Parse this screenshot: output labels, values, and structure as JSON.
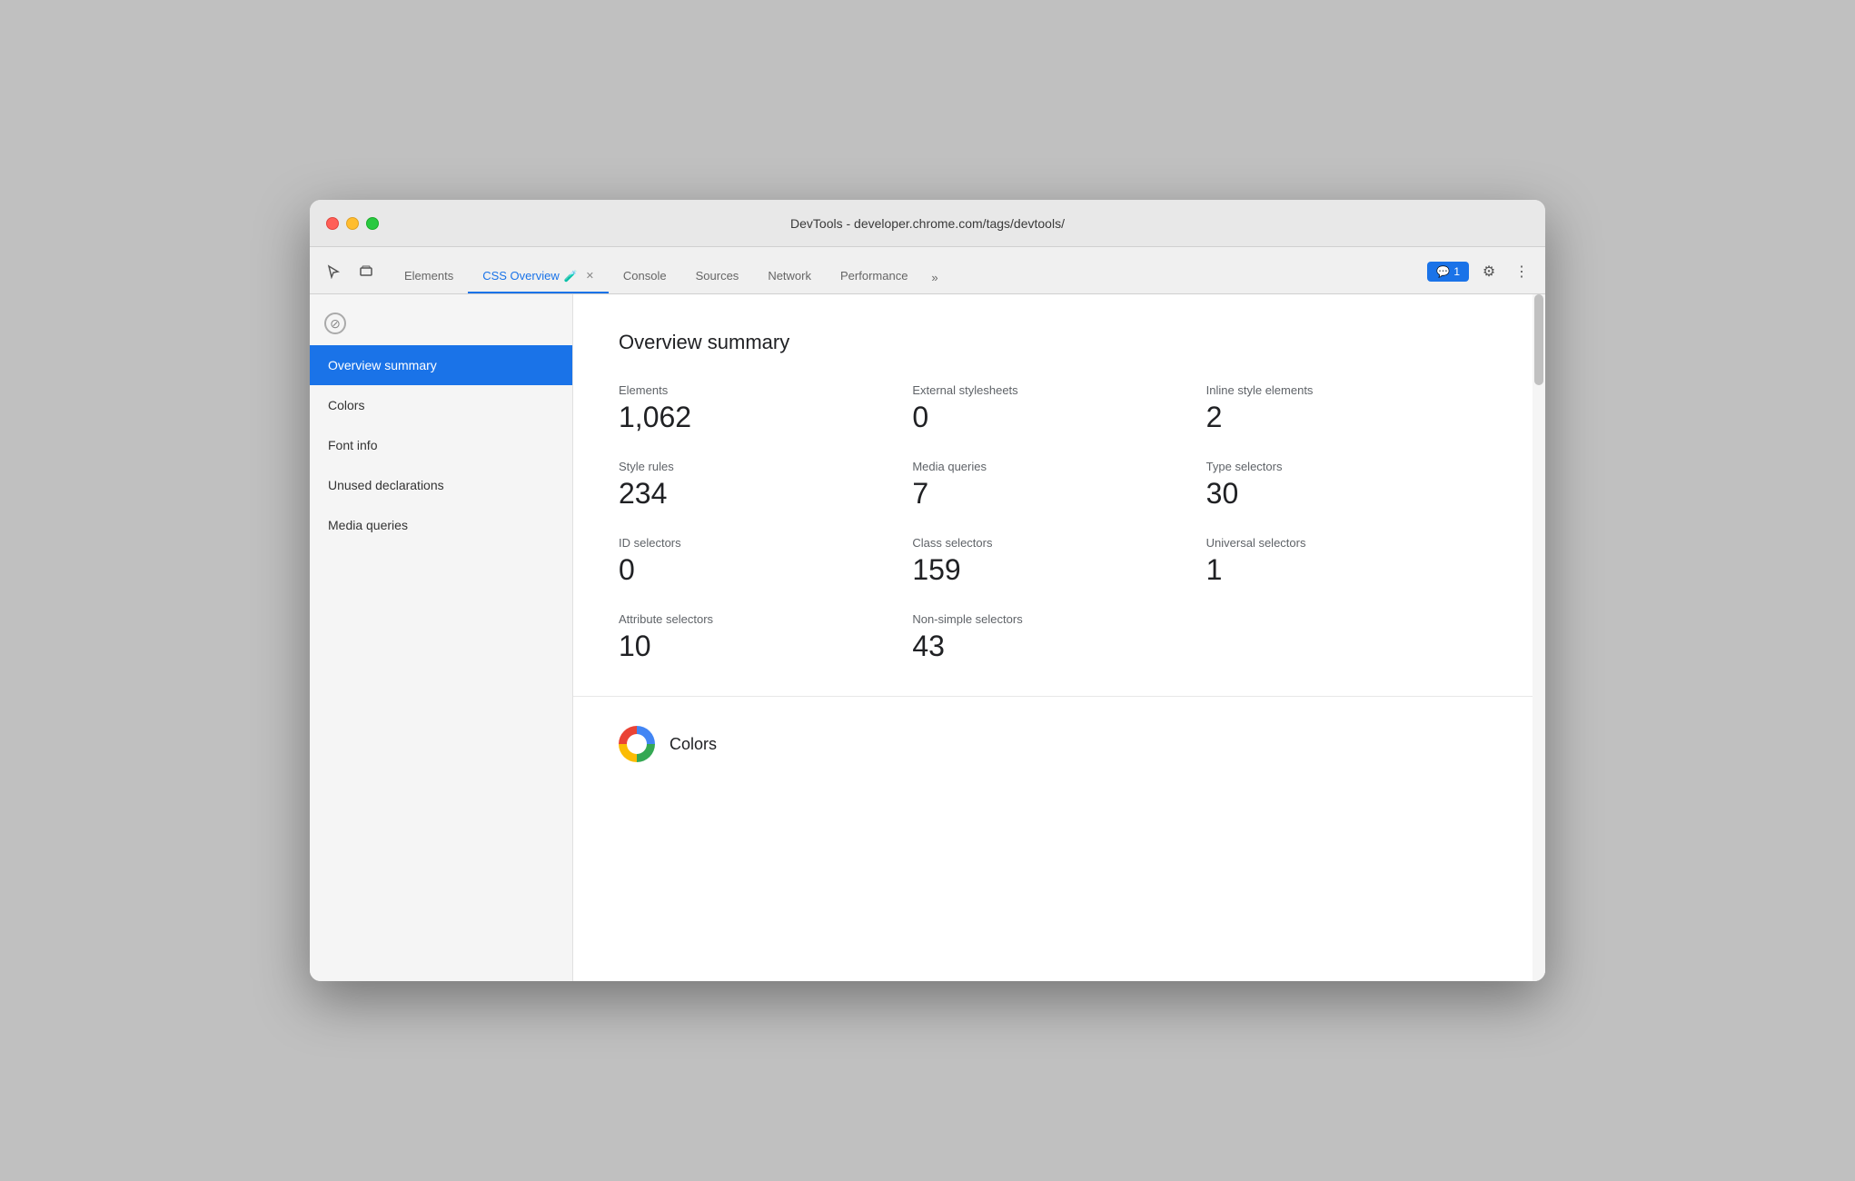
{
  "window": {
    "title": "DevTools - developer.chrome.com/tags/devtools/"
  },
  "tabs": [
    {
      "id": "elements",
      "label": "Elements",
      "active": false
    },
    {
      "id": "css-overview",
      "label": "CSS Overview",
      "active": true,
      "hasFlask": true,
      "hasClose": true
    },
    {
      "id": "console",
      "label": "Console",
      "active": false
    },
    {
      "id": "sources",
      "label": "Sources",
      "active": false
    },
    {
      "id": "network",
      "label": "Network",
      "active": false
    },
    {
      "id": "performance",
      "label": "Performance",
      "active": false
    }
  ],
  "tab_overflow_label": "»",
  "notification": {
    "icon": "💬",
    "count": "1"
  },
  "sidebar": {
    "items": [
      {
        "id": "overview-summary",
        "label": "Overview summary",
        "active": true
      },
      {
        "id": "colors",
        "label": "Colors",
        "active": false
      },
      {
        "id": "font-info",
        "label": "Font info",
        "active": false
      },
      {
        "id": "unused-declarations",
        "label": "Unused declarations",
        "active": false
      },
      {
        "id": "media-queries",
        "label": "Media queries",
        "active": false
      }
    ]
  },
  "main": {
    "overview_title": "Overview summary",
    "stats": [
      {
        "id": "elements",
        "label": "Elements",
        "value": "1,062"
      },
      {
        "id": "external-stylesheets",
        "label": "External stylesheets",
        "value": "0"
      },
      {
        "id": "inline-style-elements",
        "label": "Inline style elements",
        "value": "2"
      },
      {
        "id": "style-rules",
        "label": "Style rules",
        "value": "234"
      },
      {
        "id": "media-queries",
        "label": "Media queries",
        "value": "7"
      },
      {
        "id": "type-selectors",
        "label": "Type selectors",
        "value": "30"
      },
      {
        "id": "id-selectors",
        "label": "ID selectors",
        "value": "0"
      },
      {
        "id": "class-selectors",
        "label": "Class selectors",
        "value": "159"
      },
      {
        "id": "universal-selectors",
        "label": "Universal selectors",
        "value": "1"
      },
      {
        "id": "attribute-selectors",
        "label": "Attribute selectors",
        "value": "10"
      },
      {
        "id": "non-simple-selectors",
        "label": "Non-simple selectors",
        "value": "43"
      }
    ],
    "colors_section_title": "Colors"
  },
  "icons": {
    "cursor": "⬚",
    "layers": "▣",
    "block": "⊘",
    "settings": "⚙",
    "more": "⋮"
  }
}
